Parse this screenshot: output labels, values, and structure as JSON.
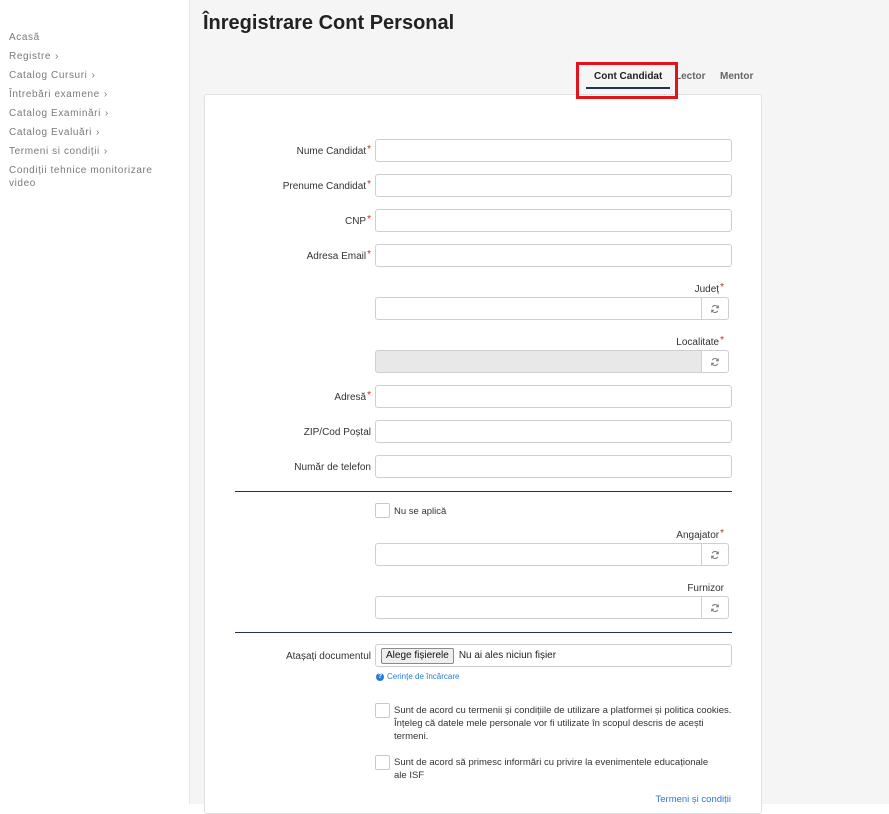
{
  "sidebar": {
    "items": [
      {
        "label": "Acasă",
        "chevron": ""
      },
      {
        "label": "Registre",
        "chevron": "›"
      },
      {
        "label": "Catalog Cursuri",
        "chevron": "›"
      },
      {
        "label": "Întrebări examene",
        "chevron": "›"
      },
      {
        "label": "Catalog Examinări",
        "chevron": "›"
      },
      {
        "label": "Catalog Evaluări",
        "chevron": "›"
      },
      {
        "label": "Termeni si condiții",
        "chevron": "›"
      },
      {
        "label": "Condiții tehnice monitorizare video",
        "chevron": ""
      }
    ]
  },
  "page": {
    "title": "Înregistrare Cont Personal"
  },
  "tabs": [
    {
      "label": "Cont Candidat",
      "active": true
    },
    {
      "label": "Lector",
      "active": false
    },
    {
      "label": "Mentor",
      "active": false
    }
  ],
  "form": {
    "required_mark": "*",
    "nume_label": "Nume Candidat",
    "nume_value": "",
    "prenume_label": "Prenume Candidat",
    "prenume_value": "",
    "cnp_label": "CNP",
    "cnp_value": "",
    "email_label": "Adresa Email",
    "email_value": "",
    "judet_label": "Județ",
    "judet_value": "",
    "localitate_label": "Localitate",
    "localitate_value": "",
    "adresa_label": "Adresă",
    "adresa_value": "",
    "zip_label": "ZIP/Cod Poștal",
    "zip_value": "",
    "telefon_label": "Număr de telefon",
    "telefon_value": "",
    "nu_se_aplica_label": "Nu se aplică",
    "angajator_label": "Angajator",
    "angajator_value": "",
    "furnizor_label": "Furnizor",
    "furnizor_value": "",
    "atasati_label": "Atașați documentul",
    "file_button_label": "Alege fișierele",
    "file_status": "Nu ai ales niciun fișier",
    "upload_help_link": "Cerințe de încărcare",
    "terms_checkbox_text": "Sunt de acord cu termenii și condițiile de utilizare a platformei și politica cookies. Înțeleg că datele mele personale vor fi utilizate în scopul descris de acești termeni.",
    "newsletter_checkbox_text": "Sunt de acord să primesc informări cu privire la evenimentele educaționale ale ISF",
    "terms_link": "Termeni și condiții"
  },
  "colors": {
    "accent_navy": "#1f3550",
    "required_red": "#d01f1f",
    "link_blue": "#2a7bd4",
    "highlight_red": "#e0141c"
  },
  "icons": {
    "refresh": "refresh-icon",
    "help": "question-circle-icon",
    "chevron": "chevron-right-icon"
  }
}
